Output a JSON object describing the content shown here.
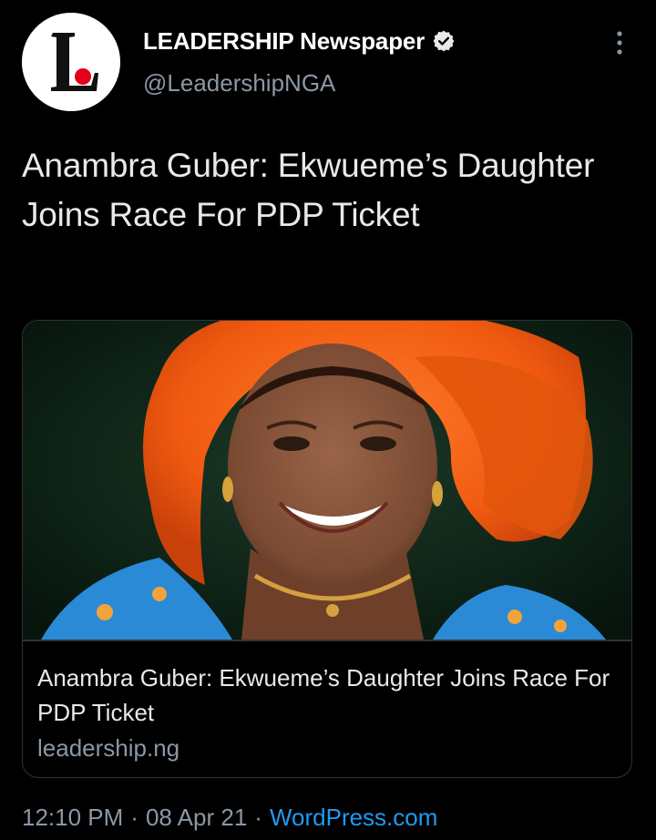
{
  "author": {
    "name": "LEADERSHIP Newspaper",
    "handle": "@LeadershipNGA",
    "avatar_icon": "leadership-logo-icon",
    "verified": true
  },
  "tweet": {
    "text": "Anambra Guber: Ekwueme’s Daughter Joins Race For PDP Ticket"
  },
  "card": {
    "image": "woman-in-orange-headtie-photo",
    "title": "Anambra Guber: Ekwueme’s Daughter Joins Race For PDP Ticket",
    "domain": "leadership.ng"
  },
  "meta": {
    "time": "12:10 PM",
    "date": "08 Apr 21",
    "separator": "·",
    "source": "WordPress.com"
  },
  "colors": {
    "background": "#000000",
    "text": "#e7e9ea",
    "secondary": "#8b98a5",
    "link": "#1d9bf0",
    "border": "#2f3336",
    "logo_red": "#e3001b"
  }
}
